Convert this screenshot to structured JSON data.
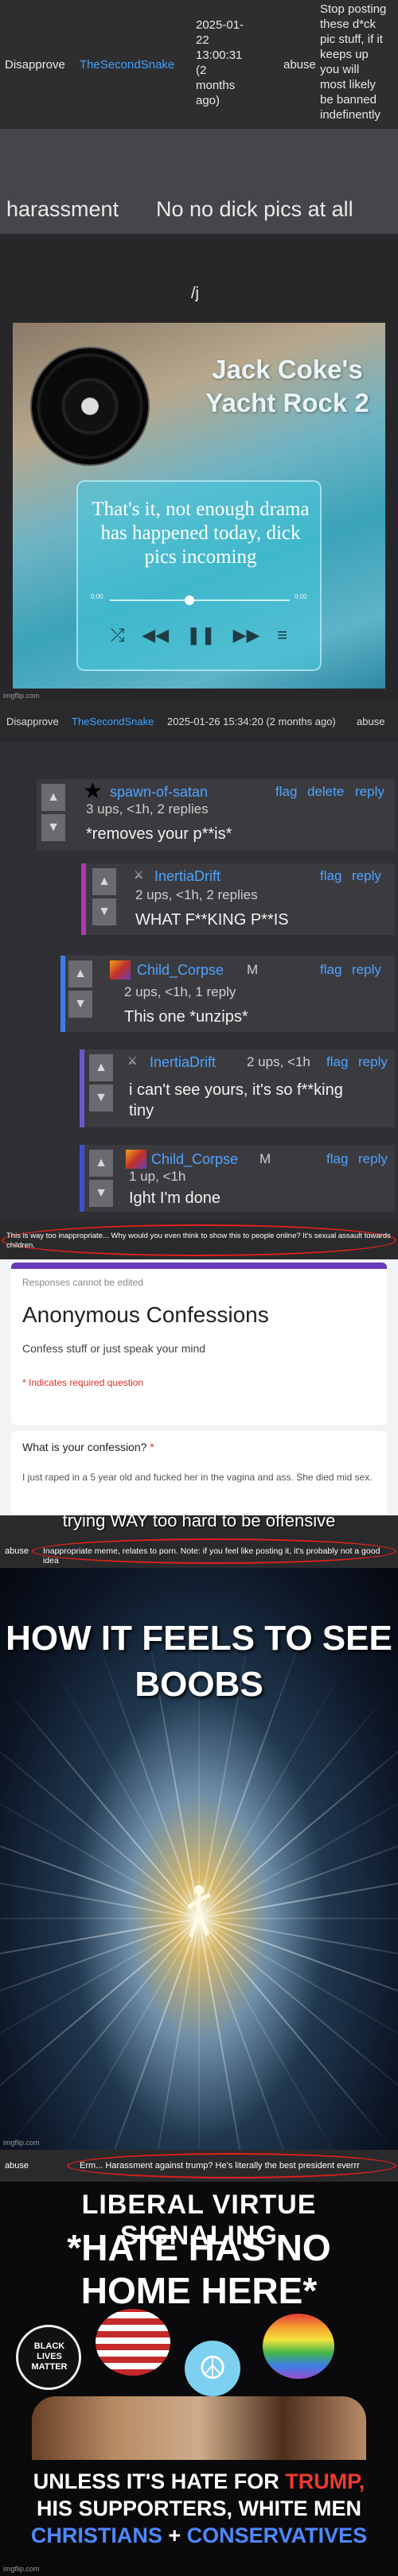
{
  "row1": {
    "action": "Disapprove",
    "user": "TheSecondSnake",
    "date": "2025-01-\n22\n13:00:31\n(2\nmonths\nago)",
    "reason": "abuse",
    "comment": "Stop posting\nthese d*ck\npic stuff, if it\nkeeps up\nyou will\nmost likely\nbe banned\nindefinently"
  },
  "harassment": {
    "label": "harassment",
    "message": "No no dick pics at all"
  },
  "template": {
    "slash": "/j",
    "title": "Jack Coke's\nYacht Rock 2",
    "player_text": "That's it, not enough drama has happened today, dick pics incoming",
    "time_start": "0:00",
    "time_end": "0:00",
    "watermark": "imgflip.com"
  },
  "row2": {
    "action": "Disapprove",
    "user": "TheSecondSnake",
    "date": "2025-01-26 15:34:20 (2 months ago)",
    "reason": "abuse"
  },
  "comments": [
    {
      "user": "spawn-of-satan",
      "meta": "3 ups, <1h, 2 replies",
      "body": "*removes your p**is*",
      "flag": "flag",
      "delete": "delete",
      "reply": "reply"
    },
    {
      "user": "InertiaDrift",
      "meta": "2 ups, <1h, 2 replies",
      "body": "WHAT F**KING P**IS",
      "flag": "flag",
      "reply": "reply"
    },
    {
      "user": "Child_Corpse",
      "badge": "M",
      "meta": "2 ups, <1h, 1 reply",
      "body": "This one *unzips*",
      "flag": "flag",
      "reply": "reply"
    },
    {
      "user": "InertiaDrift",
      "meta": "2 ups, <1h",
      "body": "i can't see yours, it's so f**king\ntiny",
      "flag": "flag",
      "reply": "reply"
    },
    {
      "user": "Child_Corpse",
      "badge": "M",
      "meta": "1 up, <1h",
      "body": "Ight I'm done",
      "flag": "flag",
      "reply": "reply"
    }
  ],
  "caption": {
    "text": "This is way too inappropriate... Why would you even think to show this to people online? It's sexual assault towards children."
  },
  "form": {
    "notice": "Responses cannot be edited",
    "title": "Anonymous Confessions",
    "description": "Confess stuff or just speak your mind",
    "required": "* Indicates required question",
    "question": "What is your confession?",
    "question_star": "*",
    "answer": "I just raped in a 5 year old and fucked her in the vagina and ass. She died mid sex."
  },
  "overlay": {
    "offensive": "trying WAY too hard to be offensive"
  },
  "row3": {
    "reason": "abuse",
    "comment": "Inappropriate meme, relates to porn. Note: if you feel like posting it, it's probably not a good idea"
  },
  "boobs": {
    "text": "HOW IT FEELS TO SEE\nBOOBS",
    "watermark": "imgflip.com"
  },
  "row4": {
    "reason": "abuse",
    "comment": "Erm... Harassment against trump? He's literally the best president everrr"
  },
  "liberal": {
    "line1": "LIBERAL VIRTUE SIGNALING",
    "line2": "*HATE HAS NO\nHOME HERE*",
    "blm": "BLACK\nLIVES\nMATTER",
    "line3_a": "UNLESS IT'S HATE FOR ",
    "line3_trump": "TRUMP,",
    "line3_b": "HIS SUPPORTERS, WHITE MEN",
    "line3_christians": "CHRISTIANS",
    "line3_c": " + ",
    "line3_conservatives": "CONSERVATIVES",
    "watermark": "imgflip.com"
  }
}
